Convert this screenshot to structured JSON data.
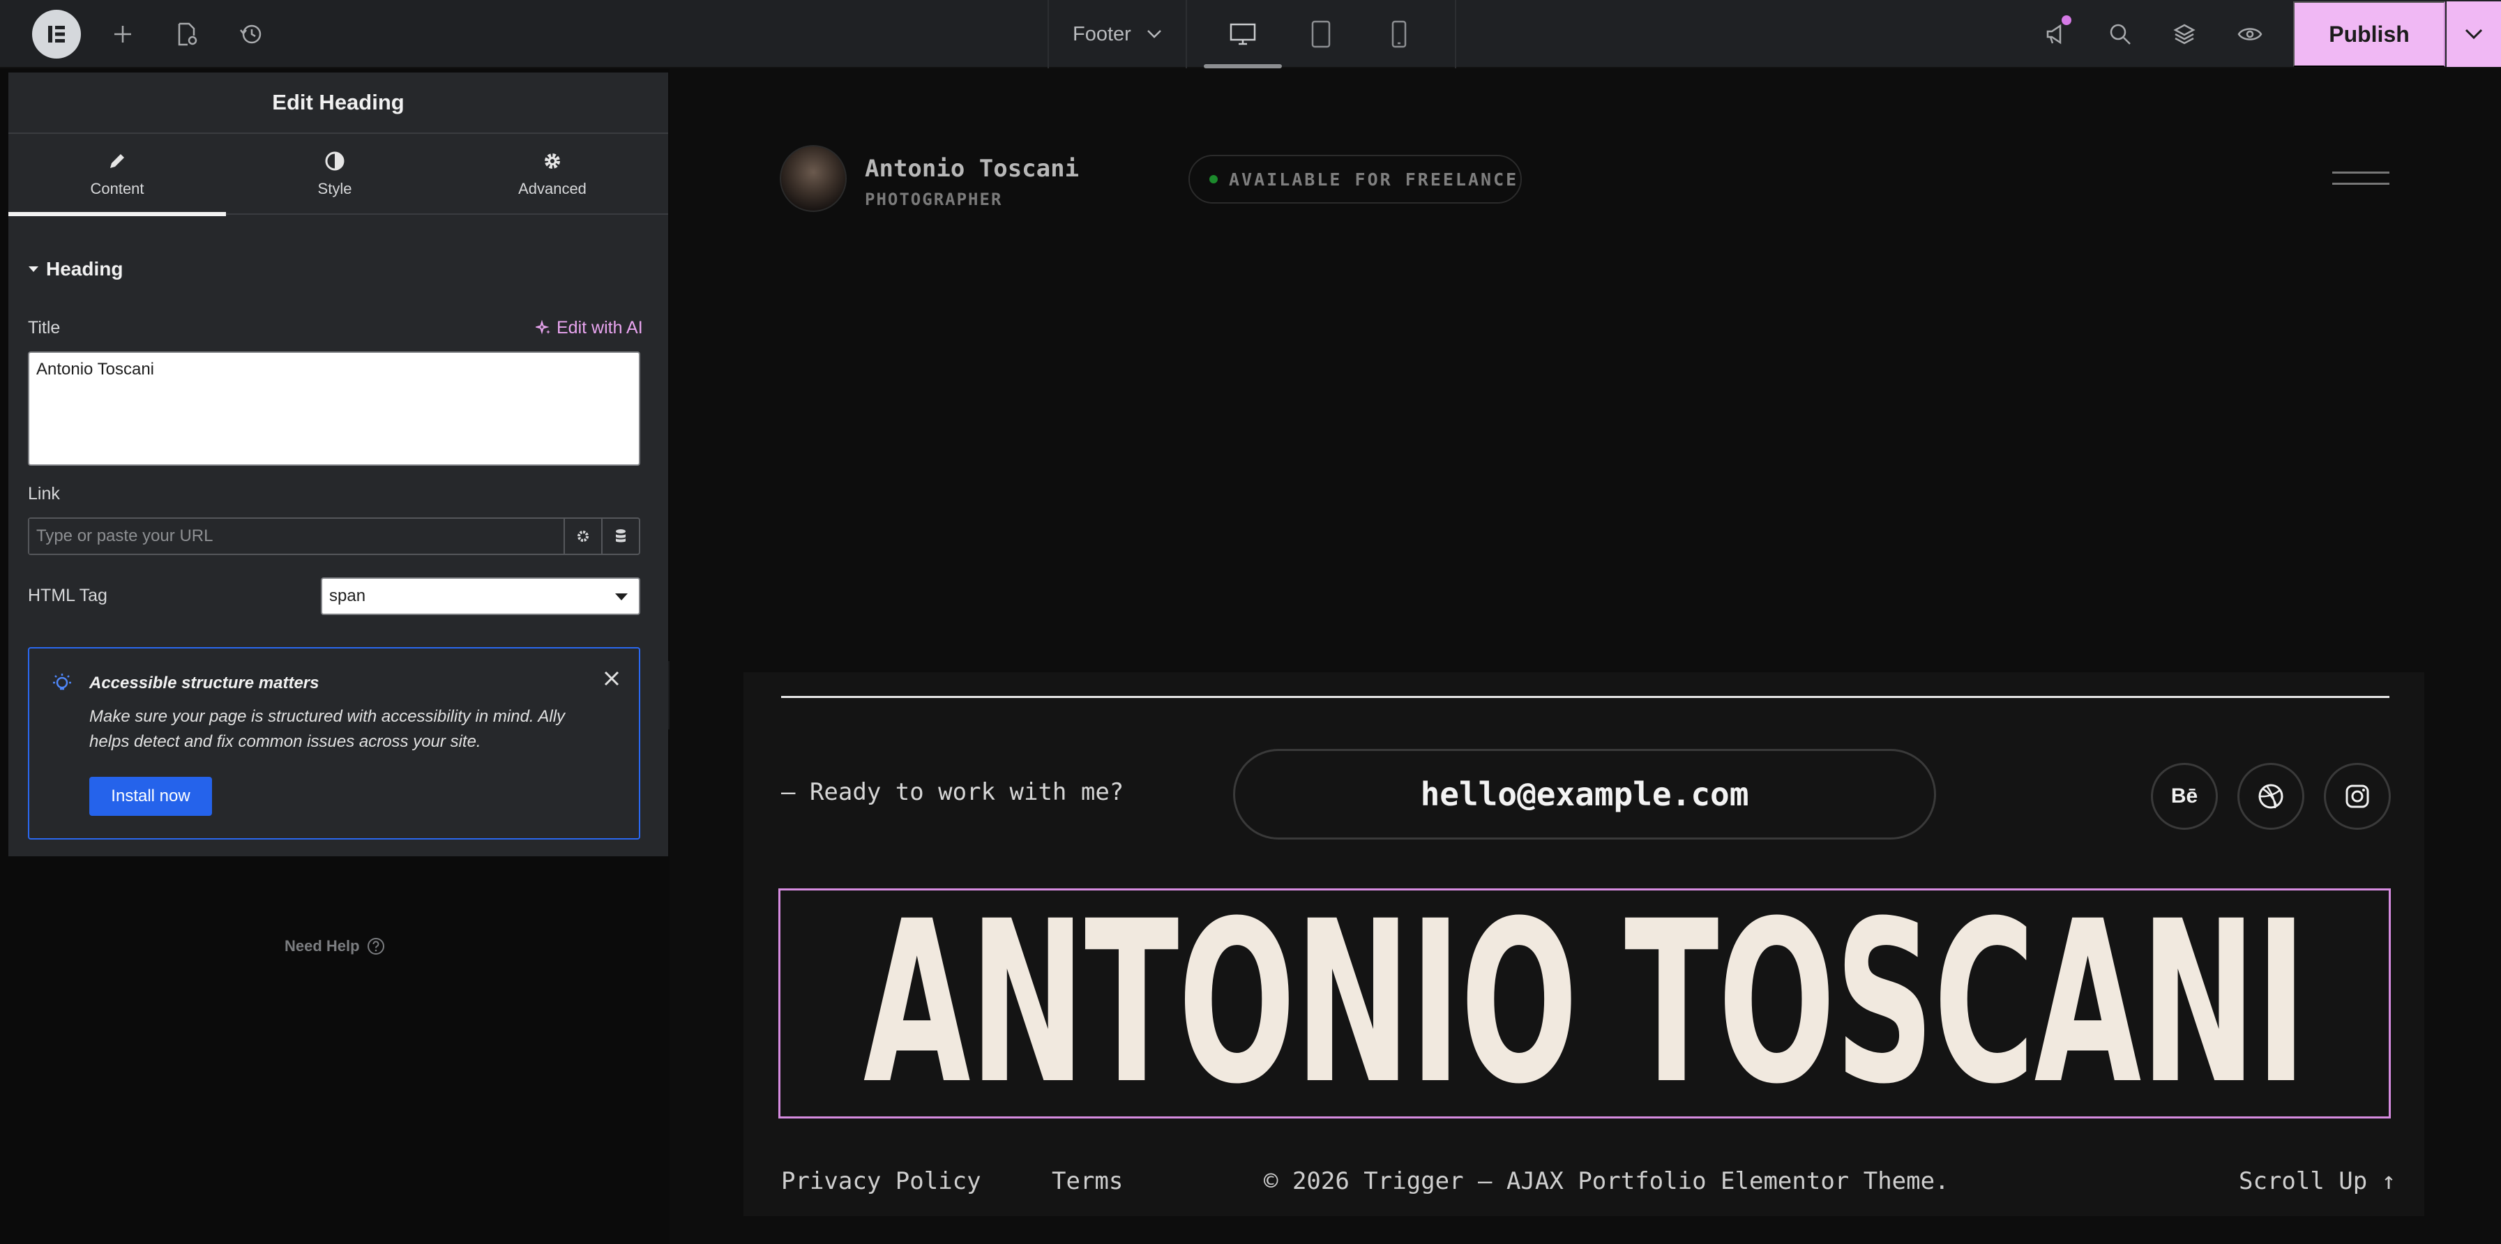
{
  "topbar": {
    "document_name": "Footer",
    "publish_label": "Publish",
    "icons": [
      "elementor-logo-icon",
      "add-icon",
      "page-settings-icon",
      "history-icon",
      "desktop-icon",
      "tablet-icon",
      "mobile-icon",
      "notifications-icon",
      "search-icon",
      "layers-icon",
      "preview-eye-icon",
      "chevron-down-icon"
    ]
  },
  "panel": {
    "title": "Edit Heading",
    "tabs": [
      {
        "label": "Content",
        "icon": "pencil-icon",
        "active": true
      },
      {
        "label": "Style",
        "icon": "contrast-icon",
        "active": false
      },
      {
        "label": "Advanced",
        "icon": "gear-icon",
        "active": false
      }
    ],
    "section_title": "Heading",
    "title_label": "Title",
    "edit_ai_label": "Edit with AI",
    "title_value": "Antonio Toscani",
    "link_label": "Link",
    "link_placeholder": "Type or paste your URL",
    "html_tag_label": "HTML Tag",
    "html_tag_value": "span",
    "notice": {
      "title": "Accessible structure matters",
      "body": "Make sure your page is structured with accessibility in mind. Ally helps detect and fix common issues across your site.",
      "button": "Install now"
    },
    "need_help": "Need Help"
  },
  "canvas": {
    "header": {
      "name": "Antonio Toscani",
      "role": "PHOTOGRAPHER",
      "availability": "AVAILABLE FOR FREELANCE"
    },
    "footer": {
      "ready_text": "— Ready to work with me?",
      "email": "hello@example.com",
      "socials": [
        "Bē"
      ],
      "big_name": "ANTONIO TOSCANI",
      "links": {
        "privacy": "Privacy Policy",
        "terms": "Terms",
        "copyright": "© 2026 Trigger — AJAX Portfolio Elementor Theme.",
        "scroll_up": "Scroll Up ↑"
      }
    }
  },
  "colors": {
    "accent_pink": "#f0b8f4",
    "ai_link": "#e9a5f0",
    "install_blue": "#2563eb",
    "status_green": "#1c8a2c"
  }
}
